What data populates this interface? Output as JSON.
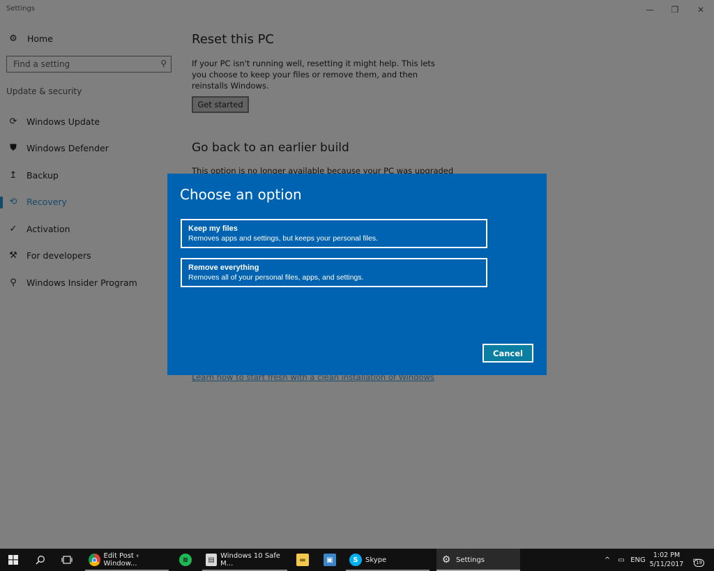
{
  "window": {
    "title": "Settings",
    "controls": {
      "minimize": "—",
      "restore": "❐",
      "close": "✕"
    }
  },
  "sidebar": {
    "home_label": "Home",
    "search_placeholder": "Find a setting",
    "section_label": "Update & security",
    "items": [
      {
        "label": "Windows Update",
        "icon": "refresh-icon",
        "glyph": "⟳"
      },
      {
        "label": "Windows Defender",
        "icon": "shield-icon",
        "glyph": "⛊"
      },
      {
        "label": "Backup",
        "icon": "backup-arrow-icon",
        "glyph": "↥"
      },
      {
        "label": "Recovery",
        "icon": "history-icon",
        "glyph": "⟲",
        "active": true
      },
      {
        "label": "Activation",
        "icon": "check-circle-icon",
        "glyph": "✓"
      },
      {
        "label": "For developers",
        "icon": "developer-tools-icon",
        "glyph": "⚒"
      },
      {
        "label": "Windows Insider Program",
        "icon": "person-icon",
        "glyph": "⚲"
      }
    ]
  },
  "main": {
    "reset_title": "Reset this PC",
    "reset_desc": "If your PC isn't running well, resetting it might help. This lets you choose to keep your files or remove them, and then reinstalls Windows.",
    "get_started_label": "Get started",
    "goback_title": "Go back to an earlier build",
    "goback_desc": "This option is no longer available because your PC was upgraded",
    "fresh_link": "Learn how to start fresh with a clean installation of Windows"
  },
  "dialog": {
    "title": "Choose an option",
    "options": [
      {
        "title": "Keep my files",
        "desc": "Removes apps and settings, but keeps your personal files."
      },
      {
        "title": "Remove everything",
        "desc": "Removes all of your personal files, apps, and settings."
      }
    ],
    "cancel_label": "Cancel",
    "accent_color": "#0063b1"
  },
  "taskbar": {
    "apps": [
      {
        "label": "Edit Post ‹ Window...",
        "icon": "chrome-icon"
      },
      {
        "label": "",
        "icon": "spotify-icon"
      },
      {
        "label": "Windows 10 Safe M...",
        "icon": "document-icon"
      },
      {
        "label": "",
        "icon": "file-explorer-icon"
      },
      {
        "label": "",
        "icon": "remote-desktop-icon"
      },
      {
        "label": "Skype",
        "icon": "skype-icon"
      },
      {
        "label": "Settings",
        "icon": "settings-gear-icon"
      }
    ],
    "language": "ENG",
    "time": "1:02 PM",
    "date": "5/11/2017",
    "notification_count": "19"
  }
}
